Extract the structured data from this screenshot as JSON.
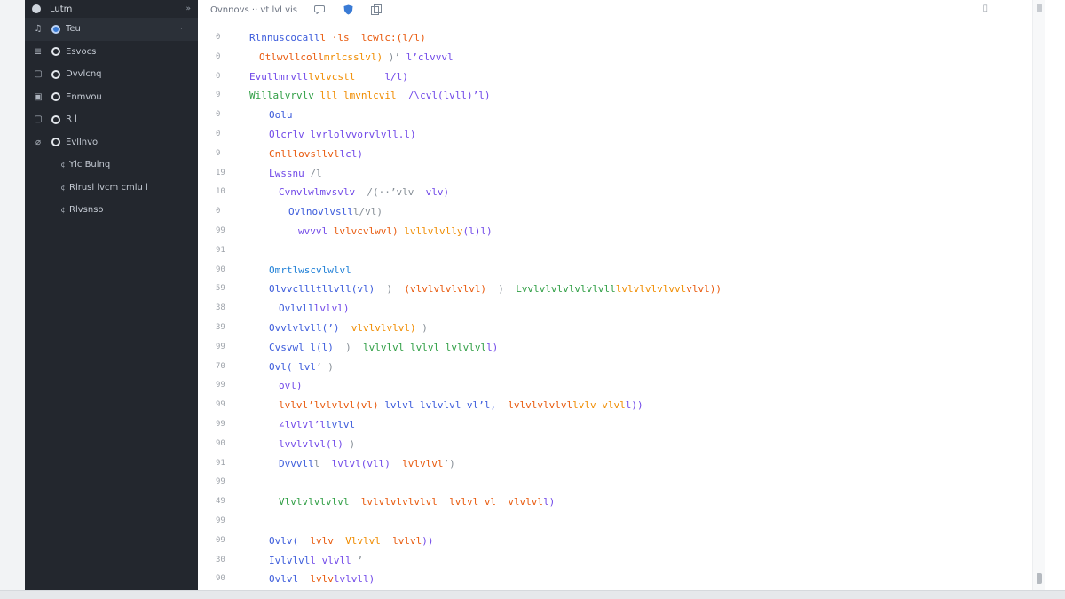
{
  "sidebar": {
    "header": {
      "title": "Lutm",
      "chevron": "»"
    },
    "items": [
      {
        "gutter": "♫",
        "label": "Teu",
        "tail": "·",
        "active": true,
        "filled": true,
        "child": false
      },
      {
        "gutter": "≣",
        "label": "Esvocs",
        "tail": "",
        "active": false,
        "filled": false,
        "child": false
      },
      {
        "gutter": "▢",
        "label": "Dvvlcnq",
        "tail": "",
        "active": false,
        "filled": false,
        "child": false
      },
      {
        "gutter": "▣",
        "label": "Enmvou",
        "tail": "",
        "active": false,
        "filled": false,
        "child": false
      },
      {
        "gutter": "▢",
        "label": "R l",
        "tail": "",
        "active": false,
        "filled": false,
        "child": false
      },
      {
        "gutter": "⌀",
        "label": "Evllnvo",
        "tail": "",
        "active": false,
        "filled": false,
        "child": false
      },
      {
        "gutter": "¢",
        "label": "Ylc Bulnq",
        "tail": "",
        "active": false,
        "filled": false,
        "child": true
      },
      {
        "gutter": "¢",
        "label": "Rlrusl lvcm cmlu l",
        "tail": "",
        "active": false,
        "filled": false,
        "child": true
      },
      {
        "gutter": "¢",
        "label": "Rlvsnso",
        "tail": "",
        "active": false,
        "filled": false,
        "child": true
      }
    ]
  },
  "toolbar": {
    "text": "Ovnnovs ·· vt lvl vis",
    "icons": [
      "message-icon",
      "shield-icon",
      "copy-icon"
    ],
    "end_glyph": "▯"
  },
  "editor": {
    "lines": [
      {
        "n": "0",
        "indent": 0,
        "parts": [
          [
            "c-blue",
            "Rlnnuscocall"
          ],
          [
            "c-red",
            "l ·ls  "
          ],
          [
            "c-red",
            "lcwlc:(l/l)"
          ]
        ]
      },
      {
        "n": "0",
        "indent": 1,
        "parts": [
          [
            "c-red",
            "Otlwvllcoll"
          ],
          [
            "c-orange",
            "mrlcsslvl)"
          ],
          [
            "c-gray",
            " )’ "
          ],
          [
            "c-violet",
            "l’clvvvl"
          ]
        ]
      },
      {
        "n": "0",
        "indent": 0,
        "parts": [
          [
            "c-violet",
            "Evullmrvll"
          ],
          [
            "c-orange",
            "lvlvcstl"
          ],
          [
            "c-gray",
            "     "
          ],
          [
            "c-violet",
            "l/l)"
          ]
        ]
      },
      {
        "n": "9",
        "indent": 0,
        "parts": [
          [
            "c-green",
            "Willalvrvlv"
          ],
          [
            "c-orange",
            " lll lmvnlcvil"
          ],
          [
            "c-gray",
            "  "
          ],
          [
            "c-violet",
            "/\\cvl(lvll)’l)"
          ]
        ]
      },
      {
        "n": "0",
        "indent": 2,
        "parts": [
          [
            "c-blue",
            "Oolu"
          ]
        ]
      },
      {
        "n": "0",
        "indent": 2,
        "parts": [
          [
            "c-violet",
            "Olcrlv lvrlo"
          ],
          [
            "c-violet",
            "lvvorvlvll.l)"
          ]
        ]
      },
      {
        "n": "9",
        "indent": 2,
        "parts": [
          [
            "c-red",
            "Cnlllovsllvl"
          ],
          [
            "c-violet",
            "lcl)"
          ]
        ]
      },
      {
        "n": "19",
        "indent": 2,
        "parts": [
          [
            "c-violet",
            "Lwssnu"
          ],
          [
            "c-gray",
            " /l"
          ]
        ]
      },
      {
        "n": "10",
        "indent": 3,
        "parts": [
          [
            "c-violet",
            "Cvnvlwlmvsvlv"
          ],
          [
            "c-gray",
            "  /(··’vlv  "
          ],
          [
            "c-violet",
            "vlv)"
          ]
        ]
      },
      {
        "n": "0",
        "indent": 4,
        "parts": [
          [
            "c-blue",
            "Ovlnovlvsll"
          ],
          [
            "c-gray",
            "l/vl)"
          ]
        ]
      },
      {
        "n": "99",
        "indent": 5,
        "parts": [
          [
            "c-violet",
            "wvvvl"
          ],
          [
            "c-red",
            " lvlvcvlwvl)"
          ],
          [
            "c-orange",
            " lvllvlvlly"
          ],
          [
            "c-violet",
            "(l)l)"
          ]
        ]
      },
      {
        "n": "91",
        "indent": 0,
        "parts": []
      },
      {
        "n": "90",
        "indent": 2,
        "parts": [
          [
            "c-teal",
            "Omrtlwscvlwlvl"
          ]
        ]
      },
      {
        "n": "59",
        "indent": 2,
        "parts": [
          [
            "c-blue",
            "Olvvcllltllvll(vl)"
          ],
          [
            "c-gray",
            "  )  "
          ],
          [
            "c-red",
            "(vlvlvlvlvlvl)"
          ],
          [
            "c-gray",
            "  )  "
          ],
          [
            "c-green",
            "Lvvlvlvlvlvlvlvll"
          ],
          [
            "c-orange",
            "lvlvlvlvlvvl"
          ],
          [
            "c-red",
            "vlvl))"
          ]
        ]
      },
      {
        "n": "38",
        "indent": 3,
        "parts": [
          [
            "c-blue",
            "Ovlvll"
          ],
          [
            "c-violet",
            "lvlvl)"
          ]
        ]
      },
      {
        "n": "39",
        "indent": 2,
        "parts": [
          [
            "c-blue",
            "Ovvlvlvll(’)"
          ],
          [
            "c-gray",
            "  "
          ],
          [
            "c-orange",
            "vlvlvlvlvl)"
          ],
          [
            "c-gray",
            " )"
          ]
        ]
      },
      {
        "n": "99",
        "indent": 2,
        "parts": [
          [
            "c-blue",
            "Cvsvwl l(l)"
          ],
          [
            "c-gray",
            "  )  "
          ],
          [
            "c-green",
            "lvlvlvl lvlvl lvlvlvl"
          ],
          [
            "c-violet",
            "l)"
          ]
        ]
      },
      {
        "n": "70",
        "indent": 2,
        "parts": [
          [
            "c-blue",
            "Ovl( lvl"
          ],
          [
            "c-gray",
            "’ )"
          ]
        ]
      },
      {
        "n": "99",
        "indent": 3,
        "parts": [
          [
            "c-violet",
            "ovl)"
          ]
        ]
      },
      {
        "n": "99",
        "indent": 3,
        "parts": [
          [
            "c-red",
            "lvlvl’lvlvlvl(vl)"
          ],
          [
            "c-gray",
            " "
          ],
          [
            "c-blue",
            "lvlvl lvlvlvl vl’l,"
          ],
          [
            "c-gray",
            "  "
          ],
          [
            "c-red",
            "lvlvlvlvlvl"
          ],
          [
            "c-orange",
            "lvlv vlvl"
          ],
          [
            "c-violet",
            "l))"
          ]
        ]
      },
      {
        "n": "99",
        "indent": 3,
        "parts": [
          [
            "c-violet",
            "∠lvlvl’l"
          ],
          [
            "c-blue",
            "lvlvl"
          ]
        ]
      },
      {
        "n": "90",
        "indent": 3,
        "parts": [
          [
            "c-violet",
            "lvvlvlvl(l)"
          ],
          [
            "c-gray",
            " )"
          ]
        ]
      },
      {
        "n": "91",
        "indent": 3,
        "parts": [
          [
            "c-blue",
            "Dvvvll"
          ],
          [
            "c-gray",
            "l  "
          ],
          [
            "c-violet",
            "lvlvl(vll)"
          ],
          [
            "c-gray",
            "  "
          ],
          [
            "c-red",
            "lvlvlvl"
          ],
          [
            "c-gray",
            "’)"
          ]
        ]
      },
      {
        "n": "99",
        "indent": 0,
        "parts": []
      },
      {
        "n": "49",
        "indent": 3,
        "parts": [
          [
            "c-green",
            "Vlvlvlvlvlvl"
          ],
          [
            "c-gray",
            "  "
          ],
          [
            "c-red",
            "lvlvlvlvlvlvl"
          ],
          [
            "c-gray",
            "  "
          ],
          [
            "c-red",
            "lvlvl vl"
          ],
          [
            "c-gray",
            "  "
          ],
          [
            "c-red",
            "vlvlvl"
          ],
          [
            "c-violet",
            "l)"
          ]
        ]
      },
      {
        "n": "99",
        "indent": 0,
        "parts": []
      },
      {
        "n": "09",
        "indent": 2,
        "parts": [
          [
            "c-blue",
            "Ovlv("
          ],
          [
            "c-gray",
            "  "
          ],
          [
            "c-red",
            "lvlv"
          ],
          [
            "c-gray",
            "  "
          ],
          [
            "c-orange",
            "Vlvlvl"
          ],
          [
            "c-gray",
            "  "
          ],
          [
            "c-red",
            "lvlvl"
          ],
          [
            "c-violet",
            "))"
          ]
        ]
      },
      {
        "n": "30",
        "indent": 2,
        "parts": [
          [
            "c-blue",
            "Ivlvlvl"
          ],
          [
            "c-violet",
            "l vlvll"
          ],
          [
            "c-gray",
            " ’"
          ]
        ]
      },
      {
        "n": "90",
        "indent": 2,
        "parts": [
          [
            "c-blue",
            "Ovlvl"
          ],
          [
            "c-gray",
            "  "
          ],
          [
            "c-red",
            "lvlv"
          ],
          [
            "c-violet",
            "lvlvll)"
          ]
        ]
      }
    ]
  },
  "colors": {
    "sidebar_bg": "#23272e",
    "accent": "#3a7bd5"
  }
}
